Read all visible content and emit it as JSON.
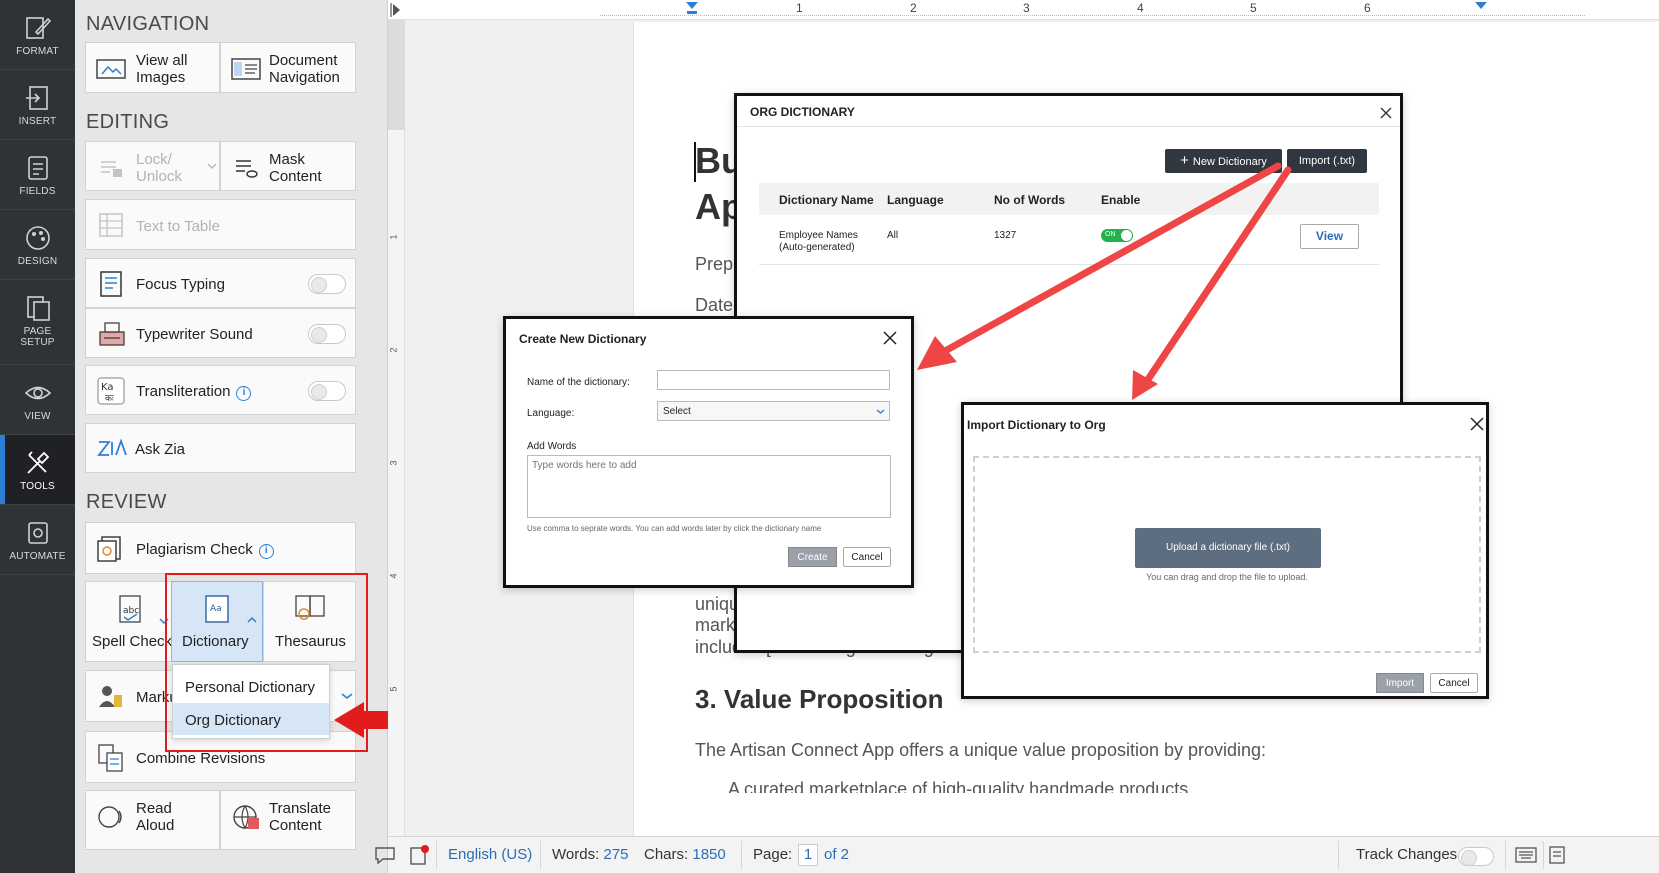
{
  "rail": [
    {
      "label": "FORMAT",
      "icon": "pen-icon"
    },
    {
      "label": "INSERT",
      "icon": "insert-icon"
    },
    {
      "label": "FIELDS",
      "icon": "fields-icon"
    },
    {
      "label": "DESIGN",
      "icon": "palette-icon"
    },
    {
      "label": "PAGE",
      "label2": "SETUP",
      "icon": "page-setup-icon"
    },
    {
      "label": "VIEW",
      "icon": "eye-icon"
    },
    {
      "label": "TOOLS",
      "icon": "tools-icon"
    },
    {
      "label": "AUTOMATE",
      "icon": "automate-icon"
    }
  ],
  "panel": {
    "navigation_title": "NAVIGATION",
    "view_images": [
      "View all",
      "Images"
    ],
    "doc_nav": [
      "Document",
      "Navigation"
    ],
    "editing_title": "EDITING",
    "lock_unlock": [
      "Lock/",
      "Unlock"
    ],
    "mask_content": [
      "Mask",
      "Content"
    ],
    "text_to_table": "Text to Table",
    "focus_typing": "Focus Typing",
    "typewriter_sound": "Typewriter Sound",
    "transliteration": "Transliteration",
    "ask_zia": "Ask Zia",
    "review_title": "REVIEW",
    "plagiarism_check": "Plagiarism Check",
    "spell_check": "Spell Check",
    "dictionary": "Dictionary",
    "thesaurus": "Thesaurus",
    "markup": "Marku",
    "dropdown": {
      "items": [
        "Personal Dictionary",
        "Org Dictionary"
      ]
    },
    "combine_revisions": "Combine Revisions",
    "read_aloud": "Read",
    "read_aloud2": "Aloud",
    "translate_content": "Translate",
    "translate_content2": "Content"
  },
  "ruler": {
    "h_marks": [
      "1",
      "2",
      "3",
      "4",
      "5",
      "6"
    ],
    "v_marks": [
      "1",
      "2",
      "3",
      "4",
      "5"
    ]
  },
  "page": {
    "heading_a": "Bu",
    "heading_b": "Ap",
    "prep": "Prep",
    "date": "Date",
    "uniq": "uniqu",
    "mark": "mark",
    "includ": "includes [Insert Target Demogr",
    "section3": "3. Value Proposition",
    "value_line": "The Artisan Connect App offers a unique value proposition by providing:",
    "bullet": "A curated marketplace of high-quality handmade products"
  },
  "org_dialog": {
    "title": "ORG DICTIONARY",
    "new_btn": "New Dictionary",
    "import_btn": "Import (.txt)",
    "columns": [
      "Dictionary Name",
      "Language",
      "No of Words",
      "Enable"
    ],
    "row": {
      "name1": "Employee Names",
      "name2": "(Auto-generated)",
      "language": "All",
      "words": "1327",
      "toggle": "ON",
      "view": "View"
    }
  },
  "create_dialog": {
    "title": "Create New Dictionary",
    "name_label": "Name of the dictionary:",
    "language_label": "Language:",
    "language_value": "Select",
    "words_label": "Add Words",
    "words_placeholder": "Type words here to add",
    "hint": "Use comma to seprate words. You can add words later by click the dictionary name",
    "create_btn": "Create",
    "cancel_btn": "Cancel"
  },
  "import_dialog": {
    "title": "Import Dictionary to Org",
    "upload_btn": "Upload a dictionary file (.txt)",
    "hint": "You can drag and drop the file to upload.",
    "import_btn": "Import",
    "cancel_btn": "Cancel"
  },
  "status": {
    "language": "English (US)",
    "words_label": "Words:",
    "words": "275",
    "chars_label": "Chars:",
    "chars": "1850",
    "page_label": "Page:",
    "page_num": "1",
    "page_of": "of 2",
    "track_changes": "Track Changes"
  },
  "colors": {
    "accent": "#2d7fd6",
    "rail_bg": "#2f3236",
    "annotation_red": "#e21c1c",
    "toggle_on": "#22b14c"
  }
}
